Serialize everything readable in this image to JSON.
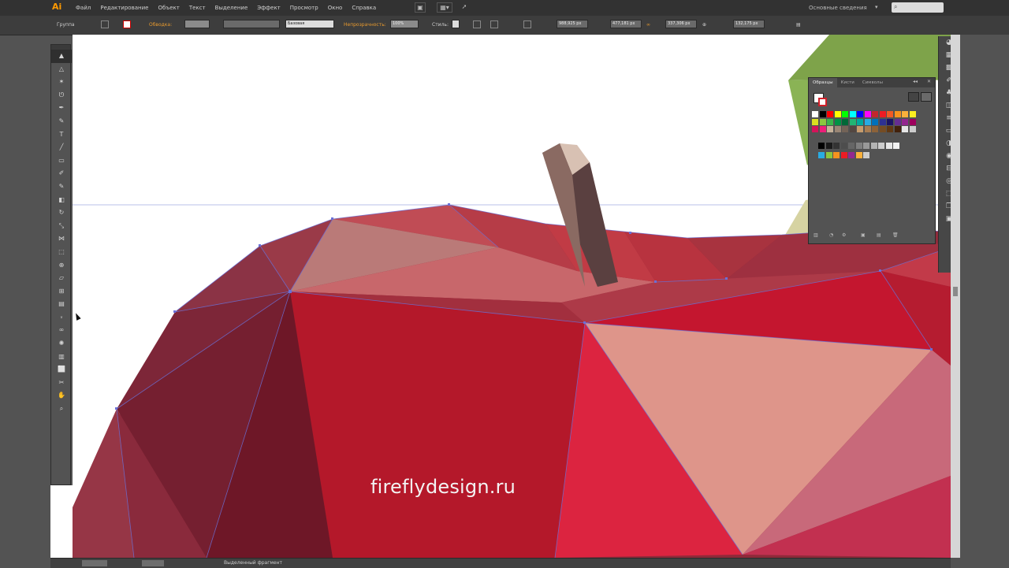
{
  "app": {
    "logo": "Ai"
  },
  "menu": [
    "Файл",
    "Редактирование",
    "Объект",
    "Текст",
    "Выделение",
    "Эффект",
    "Просмотр",
    "Окно",
    "Справка"
  ],
  "workspace": "Основные сведения",
  "control": {
    "selection_label": "Группа",
    "stroke_label": "Обводка:",
    "stroke_style": "Базовая",
    "opacity_label": "Непрозрачность:",
    "opacity_value": "100%",
    "style_label": "Стиль:",
    "x_value": "988,925 px",
    "y_value": "477,181 px",
    "w_value": "337,306 px",
    "h_value": "132,175 px"
  },
  "tools": [
    {
      "name": "selection-tool",
      "glyph": "▲",
      "sel": true
    },
    {
      "name": "direct-selection-tool",
      "glyph": "△"
    },
    {
      "name": "magic-wand-tool",
      "glyph": "✶"
    },
    {
      "name": "lasso-tool",
      "glyph": "ᘎ"
    },
    {
      "name": "pen-tool",
      "glyph": "✒"
    },
    {
      "name": "curvature-tool",
      "glyph": "✎"
    },
    {
      "name": "type-tool",
      "glyph": "T"
    },
    {
      "name": "line-tool",
      "glyph": "╱"
    },
    {
      "name": "rectangle-tool",
      "glyph": "▭"
    },
    {
      "name": "paintbrush-tool",
      "glyph": "✐"
    },
    {
      "name": "shaper-tool",
      "glyph": "✎"
    },
    {
      "name": "eraser-tool",
      "glyph": "◧"
    },
    {
      "name": "rotate-tool",
      "glyph": "↻"
    },
    {
      "name": "scale-tool",
      "glyph": "⤡"
    },
    {
      "name": "width-tool",
      "glyph": "⋈"
    },
    {
      "name": "free-transform-tool",
      "glyph": "⬚"
    },
    {
      "name": "shape-builder-tool",
      "glyph": "⊕"
    },
    {
      "name": "perspective-tool",
      "glyph": "▱"
    },
    {
      "name": "mesh-tool",
      "glyph": "⊞"
    },
    {
      "name": "gradient-tool",
      "glyph": "▤"
    },
    {
      "name": "eyedropper-tool",
      "glyph": "⍤"
    },
    {
      "name": "blend-tool",
      "glyph": "∞"
    },
    {
      "name": "symbol-sprayer-tool",
      "glyph": "✺"
    },
    {
      "name": "column-graph-tool",
      "glyph": "▥"
    },
    {
      "name": "artboard-tool",
      "glyph": "⬜"
    },
    {
      "name": "slice-tool",
      "glyph": "✂"
    },
    {
      "name": "hand-tool",
      "glyph": "✋"
    },
    {
      "name": "zoom-tool",
      "glyph": "⌕"
    }
  ],
  "swatches_panel": {
    "tabs": [
      "Образцы",
      "Кисти",
      "Символы"
    ]
  },
  "status": {
    "mode": "Выделенный фрагмент"
  },
  "watermark": "fireflydesign.ru"
}
